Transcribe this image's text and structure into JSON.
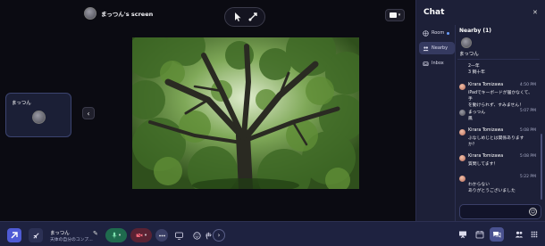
{
  "screen": {
    "title": "まっつん's screen"
  },
  "participant": {
    "name": "まっつん"
  },
  "chat": {
    "title": "Chat",
    "tabs": [
      {
        "label": "Room"
      },
      {
        "label": "Nearby"
      },
      {
        "label": "Inbox"
      }
    ],
    "nearby_header": "Nearby (1)",
    "nearby_user": "まっつん",
    "messages": [
      {
        "lines": [
          "2一年",
          "3 飼十年"
        ]
      },
      {
        "sender": "Kirara Tomizawa",
        "time": "4:50 PM",
        "text": "iPadでキーボードが届かなくて、手\nを動けられず、すみません！"
      },
      {
        "sender": "まっつん",
        "time": "5:07 PM",
        "text": "鳳"
      },
      {
        "sender": "Kirara Tomizawa",
        "time": "5:08 PM",
        "text": "ぶなしめじとは関係あります\nか？"
      },
      {
        "sender": "Kirara Tomizawa",
        "time": "5:08 PM",
        "text": "質問してます！"
      },
      {
        "sender": "",
        "time": "5:22 PM",
        "text": "わからない\nありがとうございました"
      }
    ],
    "input_placeholder": ""
  },
  "bottom_bar": {
    "user_name": "まっつん",
    "user_status": "天体の自分のコンプ…"
  },
  "colors": {
    "chat_panel_bg": "#1d2038",
    "bottom_bar_bg": "#1e2240",
    "accent": "#4f5bd5",
    "mic_on": "#1f6b4e",
    "cam_off": "#5a2233"
  }
}
